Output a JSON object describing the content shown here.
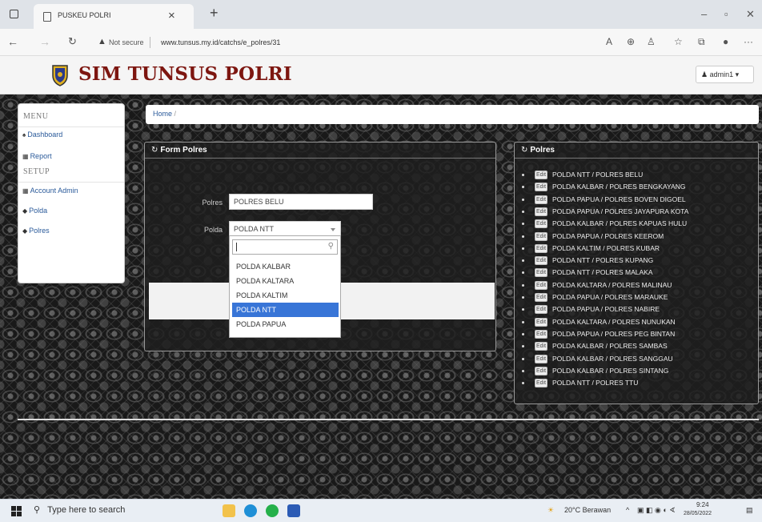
{
  "browser": {
    "tab_title": "PUSKEU POLRI",
    "not_secure": "Not secure",
    "url": "www.tunsus.my.id/catchs/e_polres/31"
  },
  "header": {
    "brand": "SIM TUNSUS POLRI",
    "user": "admin1"
  },
  "sidebar": {
    "menu_header": "MENU",
    "setup_header": "SETUP",
    "items": [
      {
        "label": "Dashboard",
        "icon": "home-icon"
      },
      {
        "label": "Report",
        "icon": "table-icon"
      },
      {
        "label": "Account Admin",
        "icon": "table-icon"
      },
      {
        "label": "Polda",
        "icon": "tag-icon"
      },
      {
        "label": "Polres",
        "icon": "tag-icon"
      }
    ]
  },
  "breadcrumb": {
    "home": "Home",
    "sep": "/"
  },
  "form_panel": {
    "title": "Form Polres",
    "polres_label": "Polres",
    "polres_value": "POLRES BELU",
    "polda_label": "Polda",
    "polda_value": "POLDA NTT",
    "search_value": "",
    "options": [
      "POLDA KALBAR",
      "POLDA KALTARA",
      "POLDA KALTIM",
      "POLDA NTT",
      "POLDA PAPUA"
    ],
    "selected_option": "POLDA NTT"
  },
  "list_panel": {
    "title": "Polres",
    "edit_label": "Edit",
    "items": [
      "POLDA NTT / POLRES BELU",
      "POLDA KALBAR / POLRES BENGKAYANG",
      "POLDA PAPUA / POLRES BOVEN DIGOEL",
      "POLDA PAPUA / POLRES JAYAPURA KOTA",
      "POLDA KALBAR / POLRES KAPUAS HULU",
      "POLDA PAPUA / POLRES KEEROM",
      "POLDA KALTIM / POLRES KUBAR",
      "POLDA NTT / POLRES KUPANG",
      "POLDA NTT / POLRES MALAKA",
      "POLDA KALTARA / POLRES MALINAU",
      "POLDA PAPUA / POLRES MARAUKE",
      "POLDA PAPUA / POLRES NABIRE",
      "POLDA KALTARA / POLRES NUNUKAN",
      "POLDA PAPUA / POLRES PEG BINTAN",
      "POLDA KALBAR / POLRES SAMBAS",
      "POLDA KALBAR / POLRES SANGGAU",
      "POLDA KALBAR / POLRES SINTANG",
      "POLDA NTT / POLRES TTU"
    ]
  },
  "taskbar": {
    "search_placeholder": "Type here to search",
    "weather": "20°C Berawan",
    "time": "9:24",
    "date": "28/05/2022"
  },
  "colors": {
    "brand": "#7d1610",
    "link": "#2a5a9a",
    "selected": "#3875d7"
  }
}
